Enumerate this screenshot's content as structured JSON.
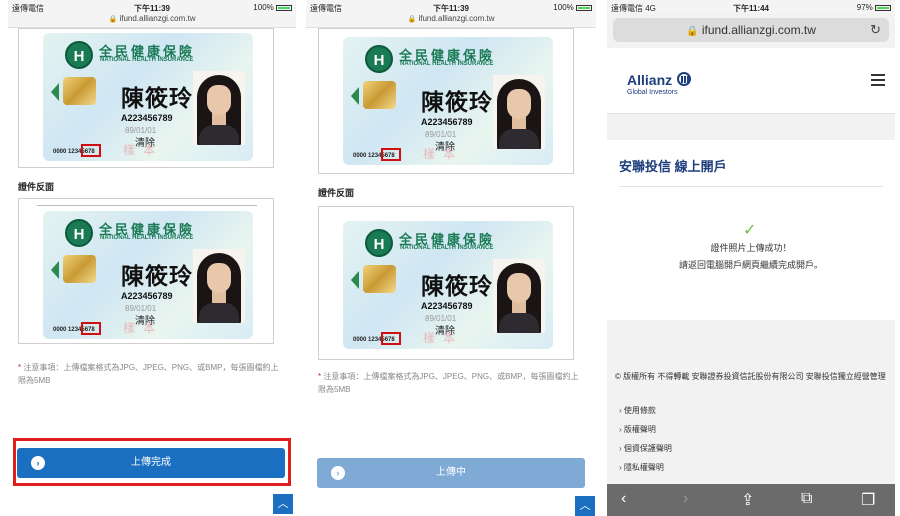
{
  "screens": [
    {
      "status": {
        "carrier": "遠傳電信",
        "time": "下午11:39",
        "battery": "100%"
      },
      "url": "ifund.allianzgi.com.tw",
      "card": {
        "title_cn": "全民健康保險",
        "title_en": "NATIONAL HEALTH INSURANCE",
        "logo_letter": "H",
        "name": "陳筱玲",
        "id_number": "A223456789",
        "dob": "89/01/01",
        "clear_label": "清除",
        "stamp": "樣本",
        "serial": "0000 12345678"
      },
      "back_label": "證件反面",
      "note": "注意事項：上傳檔案格式為JPG、JPEG、PNG、或BMP，每張圖檔約上限為5MB",
      "button_label": "上傳完成",
      "button_icon": "arrow-right-icon"
    },
    {
      "status": {
        "carrier": "遠傳電信",
        "time": "下午11:39",
        "battery": "100%"
      },
      "url": "ifund.allianzgi.com.tw",
      "back_label": "證件反面",
      "note": "注意事項：上傳檔案格式為JPG、JPEG、PNG、或BMP，每張圖檔約上限為5MB",
      "button_label": "上傳中"
    },
    {
      "status": {
        "carrier": "遠傳電信",
        "network": "4G",
        "time": "下午11:44",
        "battery": "97%"
      },
      "url": "ifund.allianzgi.com.tw",
      "brand": {
        "name": "Allianz",
        "sub": "Global Investors"
      },
      "panel_title": "安聯投信 線上開戶",
      "success_line1": "證件照片上傳成功！",
      "success_line2": "請返回電腦開戶網頁繼續完成開戶。",
      "copyright": "© 版權所有 不得轉載 安聯證券投資信託股份有限公司 安聯投信獨立經營管理",
      "footer_links": [
        "使用條款",
        "版權聲明",
        "個資保護聲明",
        "隱私權聲明"
      ]
    }
  ],
  "colors": {
    "primary_blue": "#1b6fc0",
    "disabled_blue": "#7faad6",
    "highlight_red": "#e01e1e",
    "brand_navy": "#1d3e7c"
  }
}
